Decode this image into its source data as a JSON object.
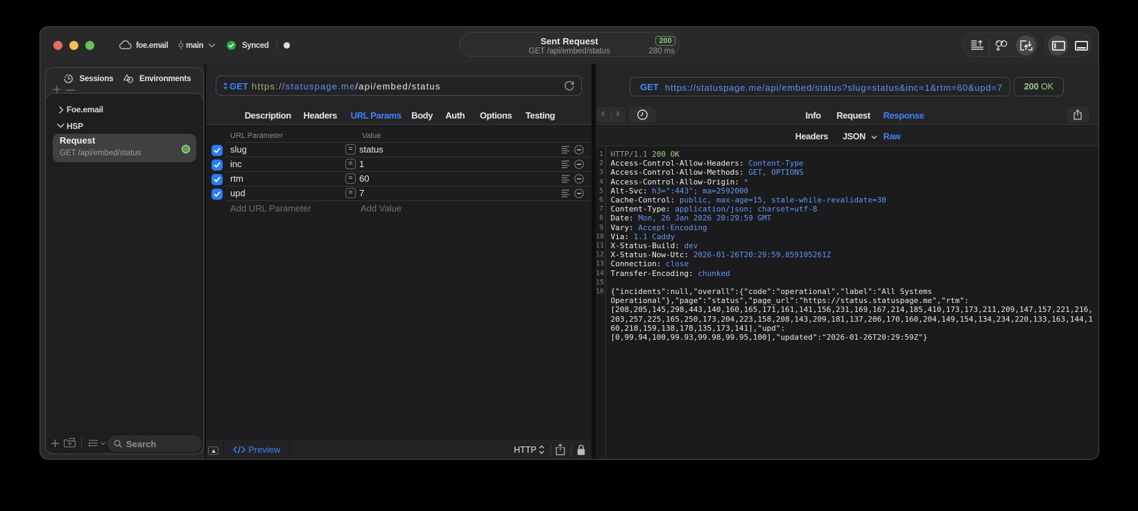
{
  "colors": {
    "accent_blue": "#3f82f8",
    "url_blue": "#5b93f2",
    "scheme_green": "#9dbd68",
    "status_green": "#a3cf87",
    "checkbox_blue": "#2e7bf6",
    "traffic_red": "#ec6b60",
    "traffic_yellow": "#f5bf4f",
    "traffic_green": "#61c454"
  },
  "titlebar": {
    "workspace": "foe.email",
    "branch": "main",
    "sync_status": "Synced",
    "request_title": "Sent Request",
    "request_subtitle": "GET /api/embed/status",
    "status_code": "200",
    "duration": "280 ms"
  },
  "sidebar": {
    "tabs": [
      {
        "label": "Sessions"
      },
      {
        "label": "Environments"
      }
    ],
    "groups": [
      {
        "label": "Foe.email",
        "expanded": false
      },
      {
        "label": "HSP",
        "expanded": true
      }
    ],
    "request_item": {
      "name": "Request",
      "method_path": "GET /api/embed/status"
    },
    "search_placeholder": "Search"
  },
  "request_pane": {
    "method": "GET",
    "url_scheme": "https",
    "url_separator": "://",
    "url_host": "statuspage.me",
    "url_path": "/api/embed/status",
    "tabs": [
      "Description",
      "Headers",
      "URL Params",
      "Body",
      "Auth",
      "Options",
      "Testing"
    ],
    "active_tab": "URL Params",
    "table": {
      "col_param": "URL Parameter",
      "col_value": "Value",
      "equals_symbol": "=",
      "rows": [
        {
          "name": "slug",
          "value": "status",
          "checked": true
        },
        {
          "name": "inc",
          "value": "1",
          "checked": true
        },
        {
          "name": "rtm",
          "value": "60",
          "checked": true
        },
        {
          "name": "upd",
          "value": "7",
          "checked": true
        }
      ],
      "add_param_placeholder": "Add URL Parameter",
      "add_value_placeholder": "Add Value"
    },
    "footer": {
      "preview_label": "Preview",
      "protocol": "HTTP"
    }
  },
  "response_pane": {
    "method": "GET",
    "url": "https://statuspage.me/api/embed/status?slug=status&inc=1&rtm=60&upd=7",
    "status_code": "200",
    "status_text": "OK",
    "tabs": [
      "Info",
      "Request",
      "Response"
    ],
    "active_tab": "Response",
    "subtabs": [
      "Headers",
      "JSON",
      "Raw"
    ],
    "active_subtab": "Raw",
    "raw_lines": [
      {
        "n": "1",
        "segs": [
          [
            "d",
            "HTTP/1.1 "
          ],
          [
            "g",
            "200 OK"
          ]
        ]
      },
      {
        "n": "2",
        "segs": [
          [
            "h",
            "Access-Control-Allow-Headers: "
          ],
          [
            "v",
            "Content-Type"
          ]
        ]
      },
      {
        "n": "3",
        "segs": [
          [
            "h",
            "Access-Control-Allow-Methods: "
          ],
          [
            "v",
            "GET, OPTIONS"
          ]
        ]
      },
      {
        "n": "4",
        "segs": [
          [
            "h",
            "Access-Control-Allow-Origin: "
          ],
          [
            "v",
            "*"
          ]
        ]
      },
      {
        "n": "5",
        "segs": [
          [
            "h",
            "Alt-Svc: "
          ],
          [
            "v",
            "h3=\":443\"; ma=2592000"
          ]
        ]
      },
      {
        "n": "6",
        "segs": [
          [
            "h",
            "Cache-Control: "
          ],
          [
            "v",
            "public, max-age=15, stale-while-revalidate=30"
          ]
        ]
      },
      {
        "n": "7",
        "segs": [
          [
            "h",
            "Content-Type: "
          ],
          [
            "v",
            "application/json; charset=utf-8"
          ]
        ]
      },
      {
        "n": "8",
        "segs": [
          [
            "h",
            "Date: "
          ],
          [
            "v",
            "Mon, 26 Jan 2026 20:29:59 GMT"
          ]
        ]
      },
      {
        "n": "9",
        "segs": [
          [
            "h",
            "Vary: "
          ],
          [
            "v",
            "Accept-Encoding"
          ]
        ]
      },
      {
        "n": "10",
        "segs": [
          [
            "h",
            "Via: "
          ],
          [
            "v",
            "1.1 Caddy"
          ]
        ]
      },
      {
        "n": "11",
        "segs": [
          [
            "h",
            "X-Status-Build: "
          ],
          [
            "v",
            "dev"
          ]
        ]
      },
      {
        "n": "12",
        "segs": [
          [
            "h",
            "X-Status-Now-Utc: "
          ],
          [
            "v",
            "2026-01-26T20:29:59.859105261Z"
          ]
        ]
      },
      {
        "n": "13",
        "segs": [
          [
            "h",
            "Connection: "
          ],
          [
            "v",
            "close"
          ]
        ]
      },
      {
        "n": "14",
        "segs": [
          [
            "h",
            "Transfer-Encoding: "
          ],
          [
            "v",
            "chunked"
          ]
        ]
      },
      {
        "n": "15",
        "segs": []
      },
      {
        "n": "16",
        "segs": [
          [
            "w",
            "{\"incidents\":null,\"overall\":{\"code\":\"operational\",\"label\":\"All Systems"
          ]
        ]
      },
      {
        "n": "",
        "segs": [
          [
            "w",
            "Operational\"},\"page\":\"status\",\"page_url\":\"https://status.statuspage.me\",\"rtm\":"
          ]
        ]
      },
      {
        "n": "",
        "segs": [
          [
            "w",
            "[208,205,145,298,443,140,160,165,171,161,141,156,231,169,167,214,185,410,173,173,211,209,147,157,221,216,"
          ]
        ]
      },
      {
        "n": "",
        "segs": [
          [
            "w",
            "203,257,225,165,250,173,204,223,158,208,143,209,181,137,206,170,160,204,149,154,134,234,220,133,163,144,1"
          ]
        ]
      },
      {
        "n": "",
        "segs": [
          [
            "w",
            "60,218,159,138,178,135,173,141],\"upd\":"
          ]
        ]
      },
      {
        "n": "",
        "segs": [
          [
            "w",
            "[0,99.94,100,99.93,99.98,99.95,100],\"updated\":\"2026-01-26T20:29:59Z\"}"
          ]
        ]
      }
    ]
  }
}
